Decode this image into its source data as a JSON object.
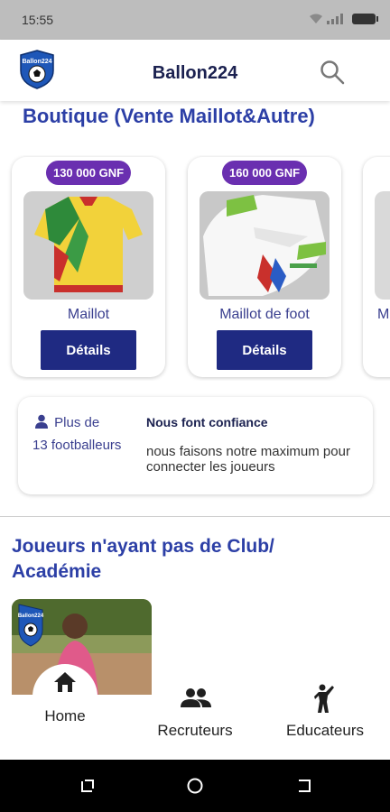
{
  "status_bar": {
    "time": "15:55"
  },
  "app_bar": {
    "title": "Ballon224",
    "logo_text": "Ballon224"
  },
  "shop": {
    "title": "Boutique (Vente Maillot&Autre)",
    "products": [
      {
        "price": "130 000 GNF",
        "name": "Maillot",
        "button": "Détails"
      },
      {
        "price": "160 000 GNF",
        "name": "Maillot de foot",
        "button": "Détails"
      },
      {
        "price": "",
        "name": "M",
        "button": ""
      }
    ]
  },
  "trust": {
    "plus_de": "Plus de",
    "count": "13 footballeurs",
    "title": "Nous font confiance",
    "text": "nous faisons notre maximum pour connecter les joueurs"
  },
  "players_section": {
    "title": "Joueurs n'ayant pas de Club/ Académie"
  },
  "bottom_nav": [
    {
      "label": "Home",
      "icon": "home-icon"
    },
    {
      "label": "Recruteurs",
      "icon": "people-icon"
    },
    {
      "label": "Educateurs",
      "icon": "sports-person-icon"
    }
  ],
  "colors": {
    "primary": "#2c3fa6",
    "button": "#1f2a82",
    "price_badge": "#6a2fb0"
  }
}
